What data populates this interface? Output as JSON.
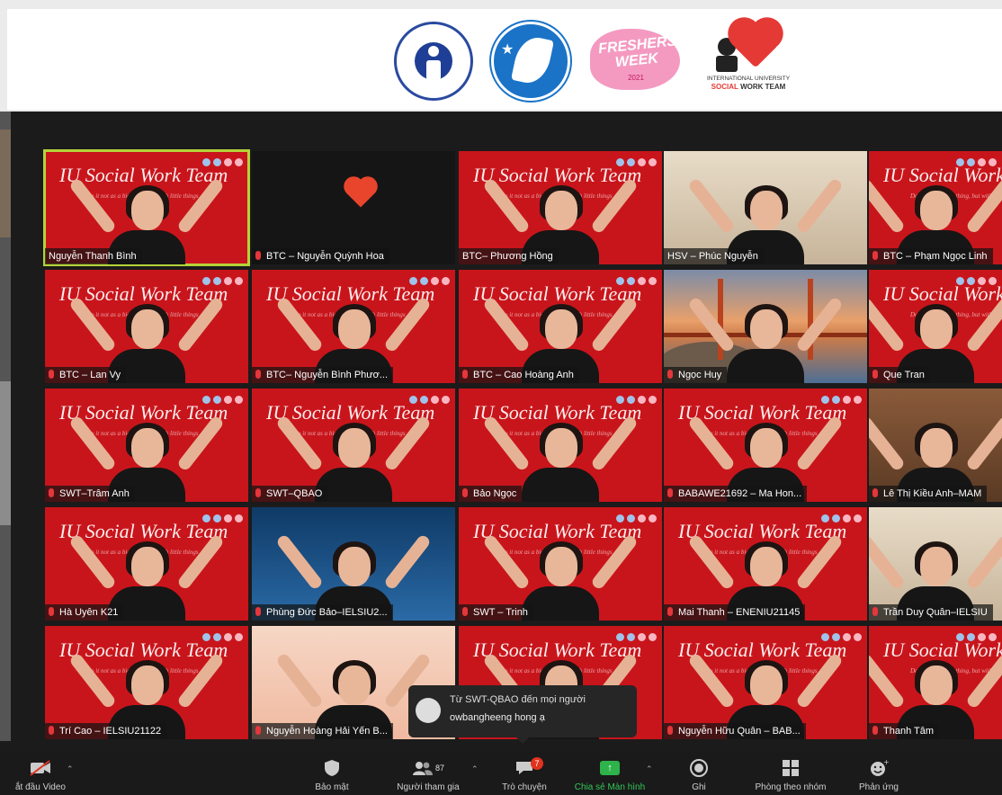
{
  "banner": {
    "fw_text_1": "FRESHERS",
    "fw_text_2": "WEEK",
    "fw_year": "2021",
    "swt_line1": "INTERNATIONAL UNIVERSITY",
    "swt_line2a": "SOCIAL",
    "swt_line2b": " WORK TEAM"
  },
  "tile_script": "IU Social Work Team",
  "tile_subtitle": "Do it not as a big thing, but with little things",
  "participants": [
    {
      "name": "Nguyễn Thanh Bình",
      "mic": false,
      "active": true
    },
    {
      "name": "BTC – Nguyễn Quỳnh Hoa",
      "mic": true,
      "bg": "dark"
    },
    {
      "name": "BTC– Phương Hồng",
      "mic": false
    },
    {
      "name": "HSV – Phúc Nguyễn",
      "mic": false,
      "bg": "room"
    },
    {
      "name": "BTC – Phạm Ngọc Linh",
      "mic": true
    },
    {
      "name": "BTC – Lan Vy",
      "mic": true
    },
    {
      "name": "BTC– Nguyễn Bình Phươ...",
      "mic": true
    },
    {
      "name": "BTC – Cao Hoàng Anh",
      "mic": true
    },
    {
      "name": "Ngọc Huy",
      "mic": true,
      "bg": "bridge"
    },
    {
      "name": "Que Tran",
      "mic": true
    },
    {
      "name": "SWT–Trâm Anh",
      "mic": true
    },
    {
      "name": "SWT–QBAO",
      "mic": true
    },
    {
      "name": "Bảo Ngọc",
      "mic": true
    },
    {
      "name": "BABAWE21692 – Ma Hon...",
      "mic": true
    },
    {
      "name": "Lê Thị Kiều Anh–MAM",
      "mic": true,
      "bg": "room2"
    },
    {
      "name": "Hà Uyên K21",
      "mic": true
    },
    {
      "name": "Phùng Đức Bảo–IELSIU2...",
      "mic": true,
      "bg": "blue"
    },
    {
      "name": "SWT – Trinh",
      "mic": true
    },
    {
      "name": "Mai Thanh – ENENIU21145",
      "mic": true
    },
    {
      "name": "Trần Duy Quân–IELSIU",
      "mic": true,
      "bg": "room"
    },
    {
      "name": "Trí Cao – IELSIU21122",
      "mic": true
    },
    {
      "name": "Nguyễn Hoàng Hải Yến B...",
      "mic": true,
      "bg": "peach"
    },
    {
      "name": "",
      "mic": false
    },
    {
      "name": "Nguyễn Hữu Quân – BAB...",
      "mic": true
    },
    {
      "name": "Thanh Tâm",
      "mic": true
    }
  ],
  "chat": {
    "from": "Từ SWT-QBAO đến mọi người",
    "message": "owbangheeng hong ạ"
  },
  "toolbar": {
    "video": "ắt đầu Video",
    "security": "Bảo mật",
    "participants": "Người tham gia",
    "participants_count": "87",
    "chat": "Trò chuyện",
    "chat_badge": "7",
    "share": "Chia sẻ Màn hình",
    "record": "Ghi",
    "breakout": "Phòng theo nhóm",
    "reactions": "Phản ứng"
  }
}
